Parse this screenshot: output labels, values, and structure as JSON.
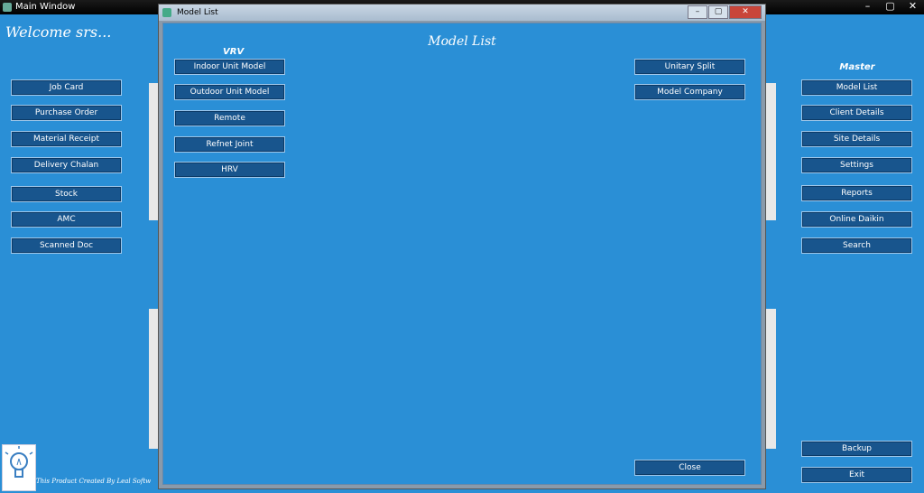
{
  "main_window": {
    "title": "Main Window",
    "controls": [
      "–",
      "▢",
      "✕"
    ]
  },
  "welcome": "Welcome srs...",
  "left_menu": [
    "Job Card",
    "Purchase Order",
    "Material Receipt",
    "Delivery Chalan",
    "Stock",
    "AMC",
    "Scanned Doc"
  ],
  "right_menu": {
    "heading": "Master",
    "items": [
      "Model List",
      "Client Details",
      "Site Details",
      "Settings",
      "Reports",
      "Online Daikin",
      "Search"
    ],
    "backup": "Backup",
    "exit": "Exit"
  },
  "footer": {
    "text": "This Product Created By Leal Softw"
  },
  "model_list_window": {
    "title": "Model List",
    "heading": "Model List",
    "vrv_heading": "VRV",
    "vrv_items": [
      "Indoor Unit Model",
      "Outdoor Unit Model",
      "Remote",
      "Refnet Joint",
      "HRV"
    ],
    "right_items": [
      "Unitary Split",
      "Model Company"
    ],
    "close_label": "Close",
    "controls": [
      "–",
      "▢",
      "✕"
    ]
  },
  "colors": {
    "background": "#2a8fd6",
    "button": "#18558d"
  }
}
